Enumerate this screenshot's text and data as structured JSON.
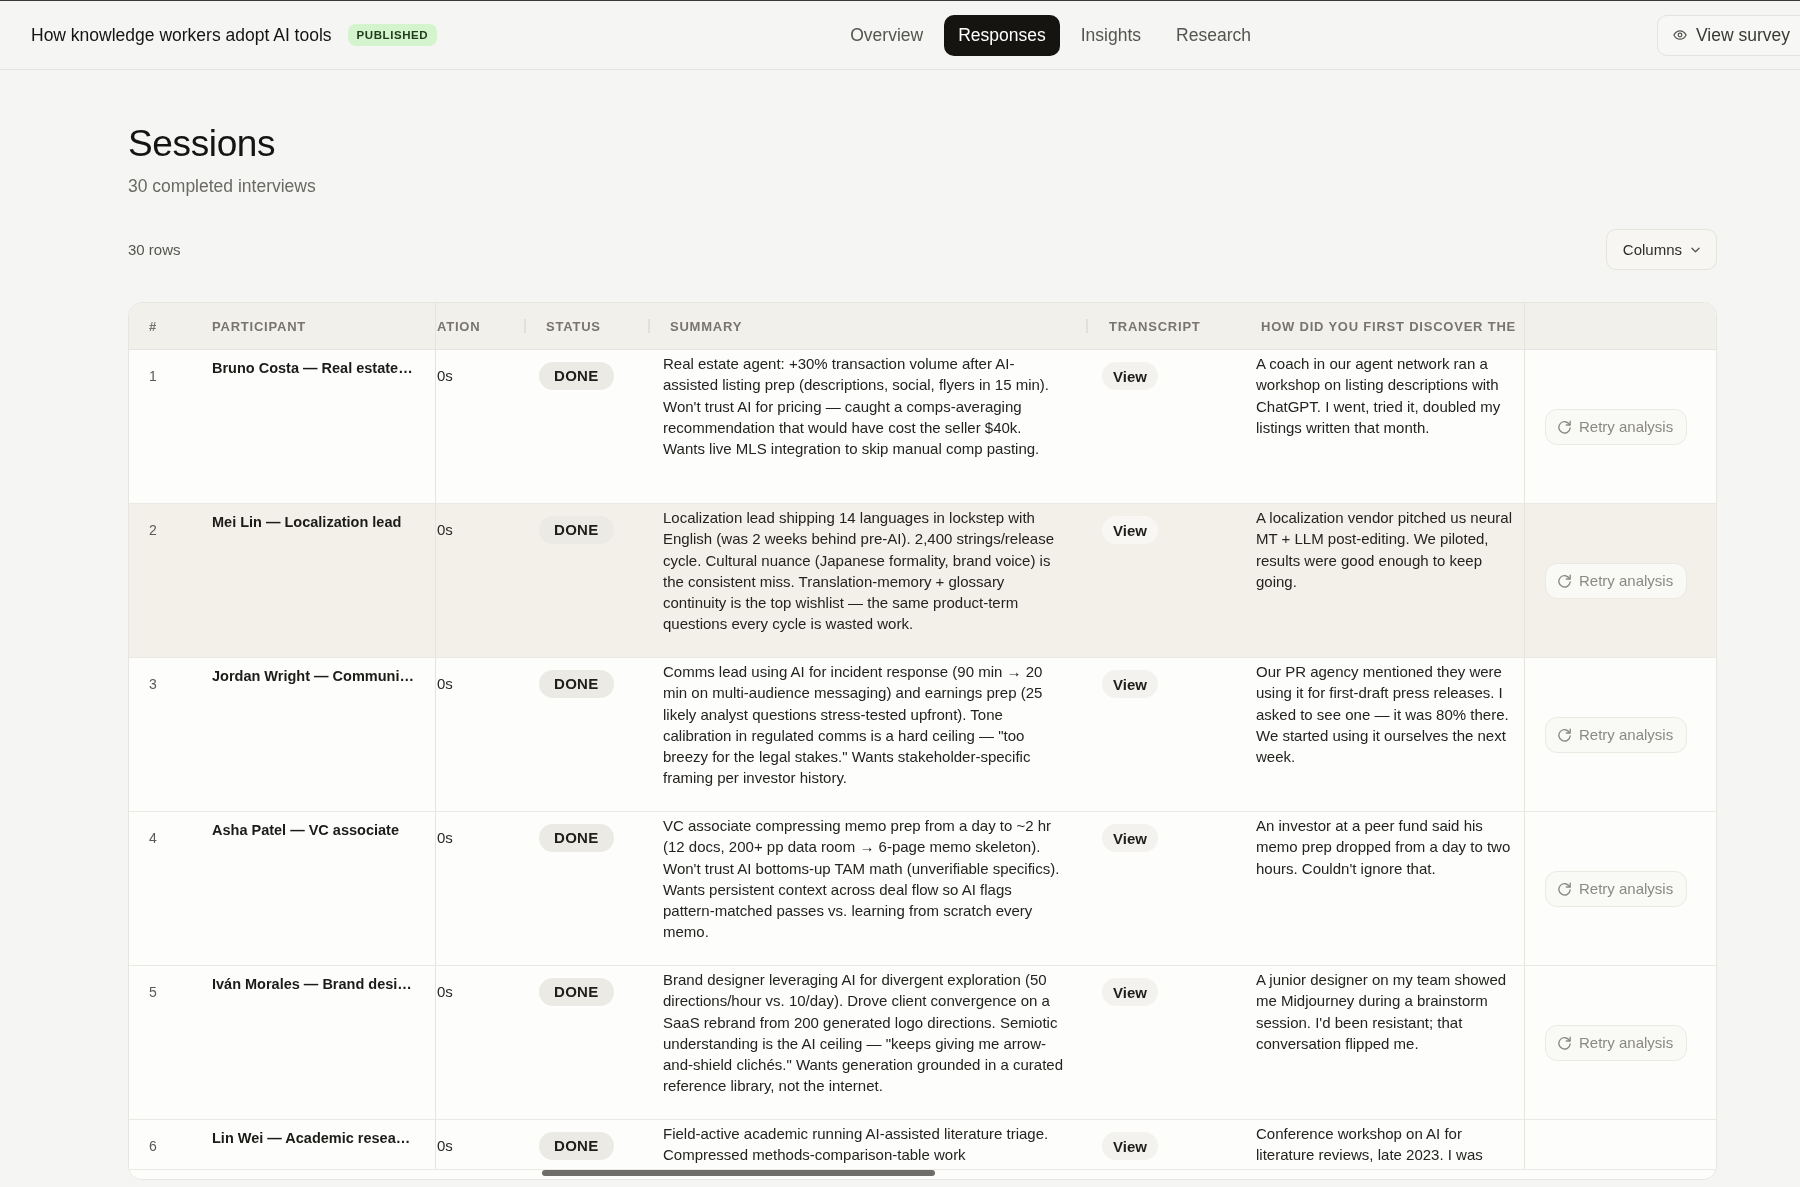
{
  "header": {
    "title": "How knowledge workers adopt AI tools",
    "status_badge": "PUBLISHED",
    "tabs": [
      {
        "label": "Overview",
        "selected": false
      },
      {
        "label": "Responses",
        "selected": true
      },
      {
        "label": "Insights",
        "selected": false
      },
      {
        "label": "Research",
        "selected": false
      }
    ],
    "view_button": "View survey"
  },
  "page": {
    "title": "Sessions",
    "subtitle": "30 completed interviews"
  },
  "toolbar": {
    "row_count": "30 rows",
    "columns_button": "Columns"
  },
  "table": {
    "columns": [
      "#",
      "PARTICIPANT",
      "ATION",
      "STATUS",
      "SUMMARY",
      "TRANSCRIPT",
      "HOW DID YOU FIRST DISCOVER THE"
    ],
    "rows": [
      {
        "number": "1",
        "participant": "Bruno Costa — Real estate…",
        "column_3": "0s",
        "status": "DONE",
        "summary": "Real estate agent: +30% transaction volume after AI-assisted listing prep (descriptions, social, flyers in 15 min). Won't trust AI for pricing — caught a comps-averaging recommendation that would have cost the seller $40k. Wants live MLS integration to skip manual comp pasting.",
        "transcript_button": "View",
        "answer": "A coach in our agent network ran a workshop on listing descriptions with ChatGPT. I went, tried it, doubled my listings written that month.",
        "action_button": "Retry analysis",
        "hovered": false
      },
      {
        "number": "2",
        "participant": "Mei Lin — Localization lead",
        "column_3": "0s",
        "status": "DONE",
        "summary": "Localization lead shipping 14 languages in lockstep with English (was 2 weeks behind pre-AI). 2,400 strings/release cycle. Cultural nuance (Japanese formality, brand voice) is the consistent miss. Translation-memory + glossary continuity is the top wishlist — the same product-term questions every cycle is wasted work.",
        "transcript_button": "View",
        "answer": "A localization vendor pitched us neural MT + LLM post-editing. We piloted, results were good enough to keep going.",
        "action_button": "Retry analysis",
        "hovered": true
      },
      {
        "number": "3",
        "participant": "Jordan Wright — Communi…",
        "column_3": "0s",
        "status": "DONE",
        "summary": "Comms lead using AI for incident response (90 min → 20 min on multi-audience messaging) and earnings prep (25 likely analyst questions stress-tested upfront). Tone calibration in regulated comms is a hard ceiling — \"too breezy for the legal stakes.\" Wants stakeholder-specific framing per investor history.",
        "transcript_button": "View",
        "answer": "Our PR agency mentioned they were using it for first-draft press releases. I asked to see one — it was 80% there. We started using it ourselves the next week.",
        "action_button": "Retry analysis",
        "hovered": false
      },
      {
        "number": "4",
        "participant": "Asha Patel — VC associate",
        "column_3": "0s",
        "status": "DONE",
        "summary": "VC associate compressing memo prep from a day to ~2 hr (12 docs, 200+ pp data room → 6-page memo skeleton). Won't trust AI bottoms-up TAM math (unverifiable specifics). Wants persistent context across deal flow so AI flags pattern-matched passes vs. learning from scratch every memo.",
        "transcript_button": "View",
        "answer": "An investor at a peer fund said his memo prep dropped from a day to two hours. Couldn't ignore that.",
        "action_button": "Retry analysis",
        "hovered": false
      },
      {
        "number": "5",
        "participant": "Iván Morales — Brand desi…",
        "column_3": "0s",
        "status": "DONE",
        "summary": "Brand designer leveraging AI for divergent exploration (50 directions/hour vs. 10/day). Drove client convergence on a SaaS rebrand from 200 generated logo directions. Semiotic understanding is the AI ceiling — \"keeps giving me arrow-and-shield clichés.\" Wants generation grounded in a curated reference library, not the internet.",
        "transcript_button": "View",
        "answer": "A junior designer on my team showed me Midjourney during a brainstorm session. I'd been resistant; that conversation flipped me.",
        "action_button": "Retry analysis",
        "hovered": false
      },
      {
        "number": "6",
        "participant": "Lin Wei — Academic resea…",
        "column_3": "0s",
        "status": "DONE",
        "summary": "Field-active academic running AI-assisted literature triage. Compressed methods-comparison-table work",
        "transcript_button": "View",
        "answer": "Conference workshop on AI for literature reviews, late 2023. I was",
        "hovered": false
      }
    ]
  }
}
